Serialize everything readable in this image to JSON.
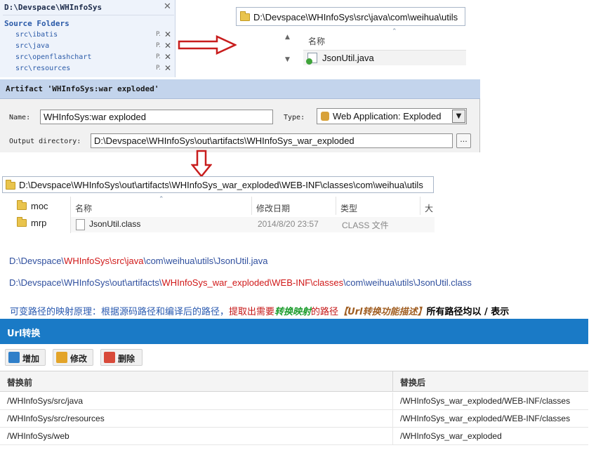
{
  "source_panel": {
    "header": "D:\\Devspace\\WHInfoSys",
    "title": "Source Folders",
    "folders": [
      "src\\ibatis",
      "src\\java",
      "src\\openflashchart",
      "src\\resources"
    ],
    "folder_tag": "P."
  },
  "java_explorer": {
    "address": "D:\\Devspace\\WHInfoSys\\src\\java\\com\\weihua\\utils",
    "column_name": "名称",
    "file": "JsonUtil.java"
  },
  "artifact": {
    "title": "Artifact 'WHInfoSys:war exploded'",
    "name_label": "Name:",
    "name_value": "WHInfoSys:war exploded",
    "type_label": "Type:",
    "type_value": "Web Application: Exploded",
    "output_label": "Output directory:",
    "output_value": "D:\\Devspace\\WHInfoSys\\out\\artifacts\\WHInfoSys_war_exploded",
    "browse_label": "..."
  },
  "out_explorer": {
    "address": "D:\\Devspace\\WHInfoSys\\out\\artifacts\\WHInfoSys_war_exploded\\WEB-INF\\classes\\com\\weihua\\utils",
    "tree": [
      "moc",
      "mrp"
    ],
    "columns": [
      "名称",
      "修改日期",
      "类型",
      "大"
    ],
    "row": {
      "name": "JsonUtil.class",
      "modified": "2014/8/20 23:57",
      "type": "CLASS 文件"
    }
  },
  "paths": {
    "source": {
      "p1": "D:\\Devspace\\",
      "p2": "WHInfoSys\\src\\java",
      "p3": "\\com\\weihua\\utils\\JsonUtil.java"
    },
    "compiled": {
      "p1": "D:\\Devspace\\WHInfoSys\\out\\artifacts\\",
      "p2": "WHInfoSys_war_exploded\\WEB-INF\\classes",
      "p3": "\\com\\weihua\\utils\\JsonUtil.class"
    }
  },
  "principle": {
    "part1": "可变路径的映射原理：根据源码路径和编译后的路径，",
    "part2": "提取出需要",
    "part3": "转换映射",
    "part4": "的路径",
    "part5": "【Url转换功能描述】",
    "part6": "所有路径均以 / 表示"
  },
  "url_panel": {
    "title": "Url转换",
    "buttons": {
      "add": "增加",
      "edit": "修改",
      "delete": "删除"
    },
    "columns": {
      "before": "替换前",
      "after": "替换后"
    },
    "rows": [
      {
        "before": "/WHInfoSys/src/java",
        "after": "/WHInfoSys_war_exploded/WEB-INF/classes"
      },
      {
        "before": "/WHInfoSys/src/resources",
        "after": "/WHInfoSys_war_exploded/WEB-INF/classes"
      },
      {
        "before": "/WHInfoSys/web",
        "after": "/WHInfoSys_war_exploded"
      }
    ]
  },
  "colors": {
    "accent_blue": "#1a7ac6",
    "path_blue": "#2f4f9e",
    "highlight_red": "#d01818",
    "highlight_green": "#1b9c2c",
    "highlight_brown": "#a05e22",
    "arrow_red": "#c81d1d"
  }
}
